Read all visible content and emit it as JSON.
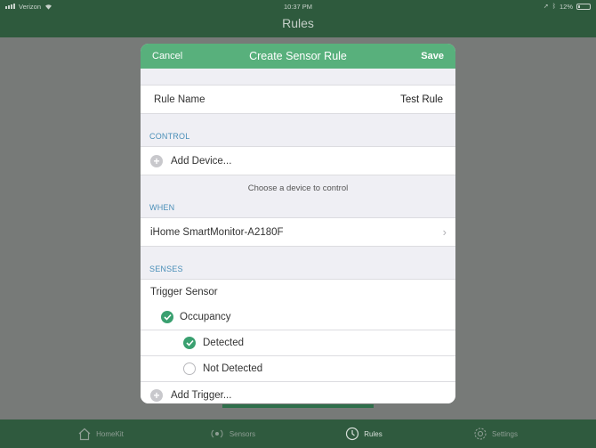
{
  "status_bar": {
    "carrier": "Verizon",
    "time": "10:37 PM",
    "battery": "12%"
  },
  "app": {
    "title": "Rules"
  },
  "modal": {
    "cancel_label": "Cancel",
    "title": "Create Sensor Rule",
    "save_label": "Save",
    "rule_name_label": "Rule Name",
    "rule_name_value": "Test Rule",
    "control_section": "CONTROL",
    "add_device_label": "Add Device...",
    "control_note": "Choose a device to control",
    "when_section": "WHEN",
    "when_device": "iHome SmartMonitor-A2180F",
    "senses_section": "SENSES",
    "trigger_sensor_label": "Trigger Sensor",
    "occupancy_label": "Occupancy",
    "occupancy_checked": true,
    "detected_label": "Detected",
    "detected_checked": true,
    "not_detected_label": "Not Detected",
    "not_detected_checked": false,
    "add_trigger_label": "Add Trigger..."
  },
  "tab_bar": {
    "tabs": [
      {
        "label": "HomeKit",
        "icon": "home-icon",
        "active": false
      },
      {
        "label": "Sensors",
        "icon": "sensor-icon",
        "active": false
      },
      {
        "label": "Rules",
        "icon": "clock-icon",
        "active": true
      },
      {
        "label": "Settings",
        "icon": "gear-icon",
        "active": false
      }
    ]
  },
  "colors": {
    "header_green": "#58b07c",
    "app_bar": "#2e5a3d",
    "section_blue": "#4a8fb8",
    "check_green": "#3aa070"
  }
}
